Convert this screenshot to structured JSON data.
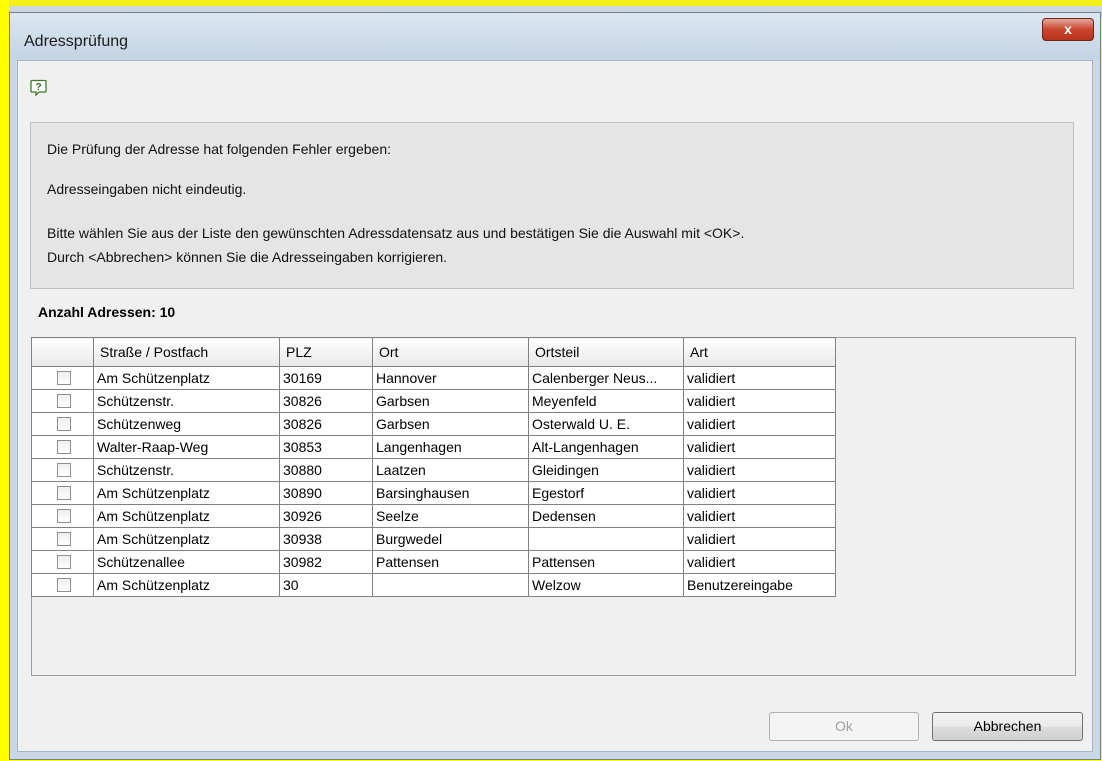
{
  "window": {
    "title": "Adressprüfung",
    "close_label": "x"
  },
  "message": {
    "line1": "Die Prüfung der Adresse hat folgenden Fehler ergeben:",
    "line2": "Adresseingaben nicht eindeutig.",
    "line3": "Bitte wählen Sie aus der Liste den gewünschten Adressdatensatz aus und bestätigen Sie die Auswahl mit <OK>.",
    "line4": "Durch <Abbrechen> können Sie die Adresseingaben korrigieren."
  },
  "count_label": "Anzahl Adressen: 10",
  "table": {
    "columns": [
      "",
      "Straße / Postfach",
      "PLZ",
      "Ort",
      "Ortsteil",
      "Art"
    ],
    "rows": [
      {
        "checked": false,
        "strasse": "Am Schützenplatz",
        "plz": "30169",
        "ort": "Hannover",
        "ortsteil": "Calenberger Neus...",
        "art": "validiert"
      },
      {
        "checked": false,
        "strasse": "Schützenstr.",
        "plz": "30826",
        "ort": "Garbsen",
        "ortsteil": "Meyenfeld",
        "art": "validiert"
      },
      {
        "checked": false,
        "strasse": "Schützenweg",
        "plz": "30826",
        "ort": "Garbsen",
        "ortsteil": "Osterwald U. E.",
        "art": "validiert"
      },
      {
        "checked": false,
        "strasse": "Walter-Raap-Weg",
        "plz": "30853",
        "ort": "Langenhagen",
        "ortsteil": "Alt-Langenhagen",
        "art": "validiert"
      },
      {
        "checked": false,
        "strasse": "Schützenstr.",
        "plz": "30880",
        "ort": "Laatzen",
        "ortsteil": "Gleidingen",
        "art": "validiert"
      },
      {
        "checked": false,
        "strasse": "Am Schützenplatz",
        "plz": "30890",
        "ort": "Barsinghausen",
        "ortsteil": "Egestorf",
        "art": "validiert"
      },
      {
        "checked": false,
        "strasse": "Am Schützenplatz",
        "plz": "30926",
        "ort": "Seelze",
        "ortsteil": "Dedensen",
        "art": "validiert"
      },
      {
        "checked": false,
        "strasse": "Am Schützenplatz",
        "plz": "30938",
        "ort": "Burgwedel",
        "ortsteil": "",
        "art": "validiert"
      },
      {
        "checked": false,
        "strasse": "Schützenallee",
        "plz": "30982",
        "ort": "Pattensen",
        "ortsteil": "Pattensen",
        "art": "validiert"
      },
      {
        "checked": false,
        "strasse": "Am Schützenplatz",
        "plz": "30",
        "ort": "",
        "ortsteil": "Welzow",
        "art": "Benutzereingabe"
      }
    ]
  },
  "buttons": {
    "ok": "Ok",
    "ok_enabled": false,
    "cancel": "Abbrechen"
  },
  "colors": {
    "close_button": "#c9452e",
    "highlight_frame": "#ffff00",
    "dialog_bg": "#f0f0f0"
  },
  "icons": {
    "help": "help-question-icon"
  }
}
